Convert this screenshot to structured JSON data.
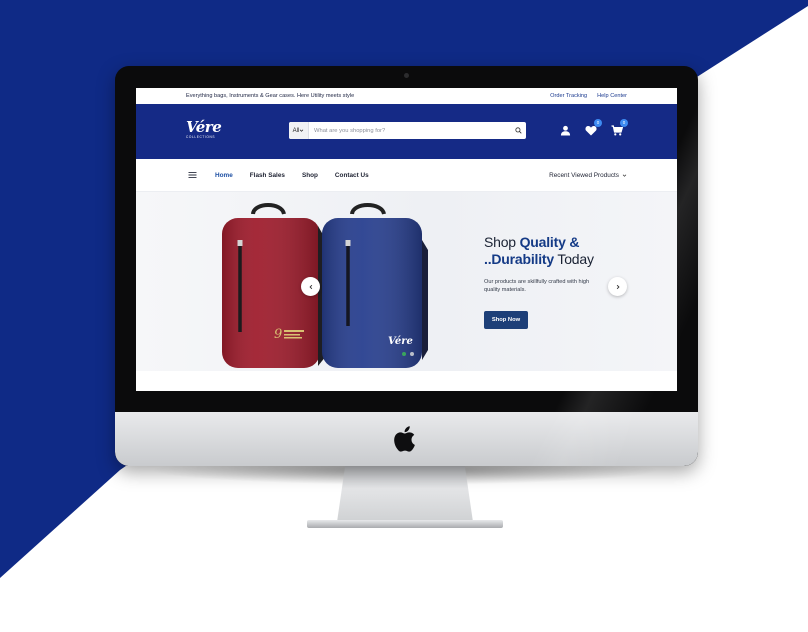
{
  "colors": {
    "navy_background": "#0f2a86",
    "header_navy": "#152a86",
    "accent_blue": "#143a86",
    "button_navy": "#1d3f78",
    "bag_red": "#9e1c2c",
    "bag_blue": "#283f8f",
    "badge_blue": "#3d8bf2",
    "active_dot": "#3aa55d"
  },
  "topbar": {
    "tagline": "Everything bags, Instruments & Gear cases. Here Utility meets style",
    "order_tracking": "Order Tracking",
    "help_center": "Help Center"
  },
  "header": {
    "logo_text": "Vére",
    "logo_subtext": "COLLECTIONS",
    "search": {
      "category": "All",
      "placeholder": "What are you shopping for?"
    },
    "wishlist_count": "0",
    "cart_count": "0",
    "icons": [
      "user-icon",
      "heart-icon",
      "cart-icon",
      "search-icon"
    ]
  },
  "nav": {
    "items": [
      "Home",
      "Flash Sales",
      "Shop",
      "Contact Us"
    ],
    "active": "Home",
    "recent": "Recent Viewed Products"
  },
  "hero": {
    "title_word1": "Shop",
    "title_bold1": "Quality &",
    "title_bold2": "..Durability",
    "title_word2": "Today",
    "description": "Our products are skillfully crafted with high quality materials.",
    "button": "Shop Now",
    "slides": 2,
    "active_slide": 1,
    "bag_logo": "Vére"
  }
}
